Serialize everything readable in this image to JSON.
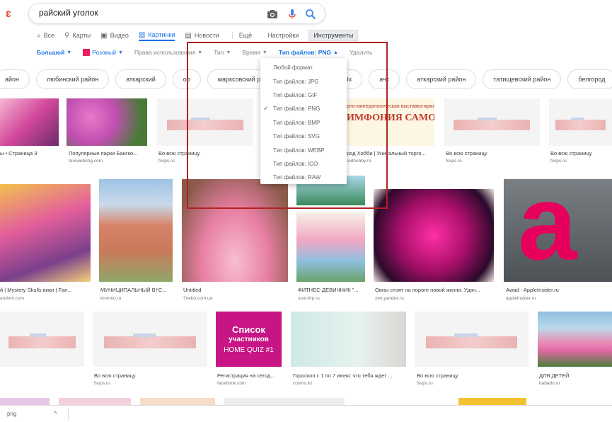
{
  "search": {
    "query": "райский уголок"
  },
  "tabs": [
    {
      "label": "Все",
      "icon": "search-icon"
    },
    {
      "label": "Карты",
      "icon": "map-pin-icon"
    },
    {
      "label": "Видео",
      "icon": "video-icon"
    },
    {
      "label": "Картинки",
      "icon": "image-icon"
    },
    {
      "label": "Новости",
      "icon": "news-icon"
    },
    {
      "label": "Ещё",
      "icon": "more-icon"
    },
    {
      "label": "Настройки"
    },
    {
      "label": "Инструменты"
    }
  ],
  "filters": {
    "size": "Большой",
    "color": "Розовый",
    "color_hex": "#e91e63",
    "rights": "Права использования",
    "type": "Тип",
    "time": "Время",
    "filetype": "Тип файлов: PNG",
    "remove": "Удалить"
  },
  "chips": [
    "айон",
    "любинский район",
    "аткарский",
    "оо",
    "марксовский ра",
    "",
    "olx",
    "ачс",
    "аткарский район",
    "татищевский район",
    "белгород"
  ],
  "dropdown": {
    "items": [
      "Любой формат",
      "Тип файлов: JPG",
      "Тип файлов: GIF",
      "Тип файлов: PNG",
      "Тип файлов: BMP",
      "Тип файлов: SVG",
      "Тип файлов: WEBP",
      "Тип файлов: ICO",
      "Тип файлов: RAW"
    ],
    "selected_index": 3
  },
  "results": {
    "r1": [
      {
        "title": "ы • Страница 3",
        "source": ""
      },
      {
        "title": "Популярные парки Бангко...",
        "source": "tourwebring.com"
      },
      {
        "title": "Во всю страницу",
        "source": "fsvps.ru"
      },
      {
        "title": "род Хобби | Уникальный торго...",
        "source": "rodhobby.ru"
      },
      {
        "title": "Во всю страницу",
        "source": "fsvps.ru"
      },
      {
        "title": "Во всю страницу",
        "source": "fsvps.ru"
      }
    ],
    "r2": [
      {
        "title": "й | Mystery Skulls вики | Fan...",
        "source": "andom.com"
      },
      {
        "title": "МУНИЦИПАЛЬНЫЙ В†С...",
        "source": "kronmo.ru"
      },
      {
        "title": "Untitled",
        "source": "7nebo.com.ua"
      },
      {
        "title": "ФИТНЕС-ДЕВИЧНИК \"...",
        "source": "soul-trip.ru"
      },
      {
        "title": "Овны стоят на пороге новой жизни. Удач...",
        "source": "zen.yandex.ru"
      },
      {
        "title": "Awad - AppleInsider.ru",
        "source": "appleinsider.ru"
      }
    ],
    "r3": [
      {
        "title": "Во всю страницу",
        "source": "fsvps.ru"
      },
      {
        "title": "Регистрация на сегод...",
        "source": "facebook.com"
      },
      {
        "title": "Гороскоп с 1 по 7 июня: что тебя ждет ...",
        "source": "cosmo.kz"
      },
      {
        "title": "Во всю страницу",
        "source": "fsvps.ru"
      },
      {
        "title": "ДЛЯ ДЕТЕЙ",
        "source": "babadu.ru"
      }
    ]
  },
  "banner": {
    "subtitle": "рно-минералогическая выставка-ярмарк",
    "title": "ИМФОНИЯ САМОЦВЕТО"
  },
  "quiz": {
    "line1": "Список",
    "line2": "участников",
    "line3": "HOME QUIZ #1"
  },
  "download": {
    "name": "png"
  }
}
